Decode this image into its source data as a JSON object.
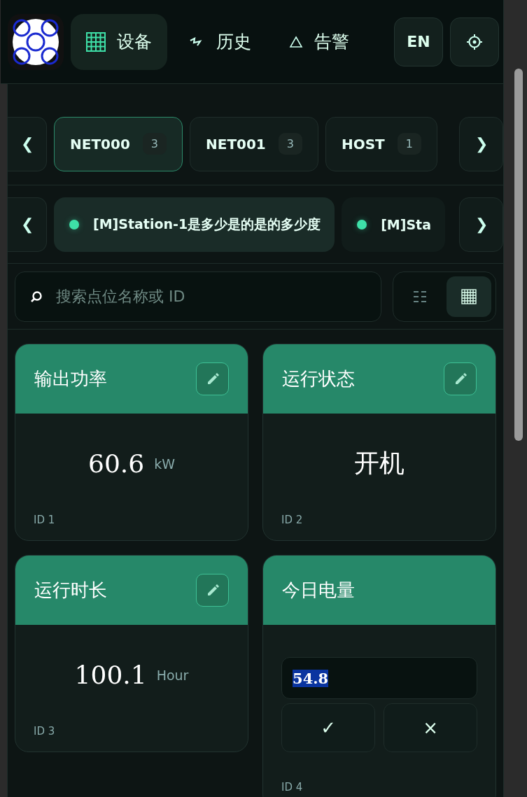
{
  "header": {
    "nav": [
      {
        "label": "设备",
        "kind": "grid",
        "selected": true
      },
      {
        "label": "历史",
        "kind": "pulse",
        "selected": false
      },
      {
        "label": "告警",
        "kind": "warning",
        "selected": false
      }
    ],
    "language": "EN"
  },
  "groups": {
    "prev": "❮",
    "next": "❯",
    "items": [
      {
        "label": "NET000",
        "count": "3",
        "selected": true
      },
      {
        "label": "NET001",
        "count": "3",
        "selected": false
      },
      {
        "label": "HOST",
        "count": "1",
        "selected": false
      }
    ]
  },
  "stations": {
    "prev": "❮",
    "next": "❯",
    "items": [
      {
        "label": "[M]Station-1是多少是的是的多少度",
        "color": "#3ee0a8",
        "selected": true
      },
      {
        "label": "[M]Sta",
        "color": "#3ee0a8",
        "selected": false
      }
    ]
  },
  "search": {
    "placeholder": "搜索点位名称或 ID"
  },
  "view": {
    "list_selected": false,
    "grid_selected": true
  },
  "cards": [
    {
      "kind": "display",
      "title": "输出功率",
      "value": "60.6",
      "unit": "kW",
      "id": "ID 1"
    },
    {
      "kind": "display",
      "title": "运行状态",
      "value": "开机",
      "id": "ID 2"
    },
    {
      "kind": "display",
      "title": "运行时长",
      "value": "100.1",
      "unit": "Hour",
      "id": "ID 3"
    },
    {
      "kind": "editing",
      "title": "今日电量",
      "value": "54.8",
      "value_selected": true,
      "confirm": "✓",
      "cancel": "×",
      "id": "ID 4"
    }
  ]
}
